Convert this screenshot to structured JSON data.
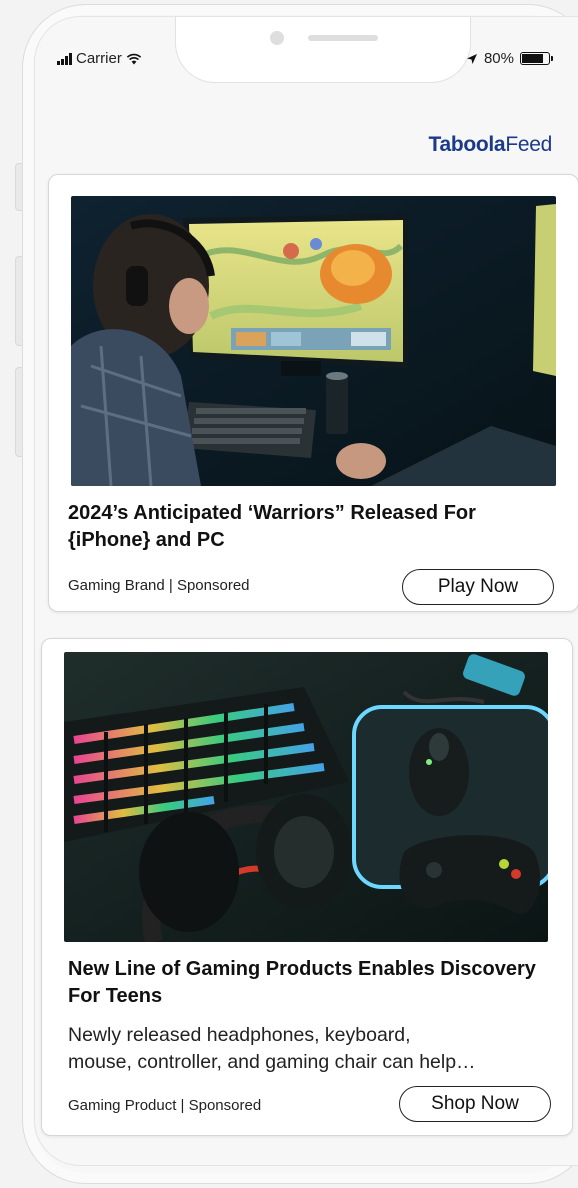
{
  "status_bar": {
    "carrier": "Carrier",
    "battery": "80%",
    "battery_level": 0.8
  },
  "brand": {
    "part1": "Taboola",
    "part2": "Feed"
  },
  "cards": [
    {
      "headline": "2024’s Anticipated ‘Warriors” Released For {iPhone} and PC",
      "meta": "Gaming Brand | Sponsored",
      "cta": "Play Now",
      "image": "gaming-setup-photo"
    },
    {
      "headline": "New Line of Gaming Products Enables Discovery For Teens",
      "description_line1": "Newly released headphones, keyboard,",
      "description_line2": "mouse, controller, and gaming chair can help…",
      "meta": "Gaming Product | Sponsored",
      "cta": "Shop Now",
      "image": "gaming-peripherals-photo"
    }
  ],
  "icons": {
    "signal": "signal-bars-icon",
    "wifi": "wifi-icon",
    "location": "location-arrow-icon",
    "battery": "battery-icon"
  },
  "colors": {
    "brand": "#1b3a8a",
    "background": "#f7f7f7",
    "card": "#ffffff"
  }
}
